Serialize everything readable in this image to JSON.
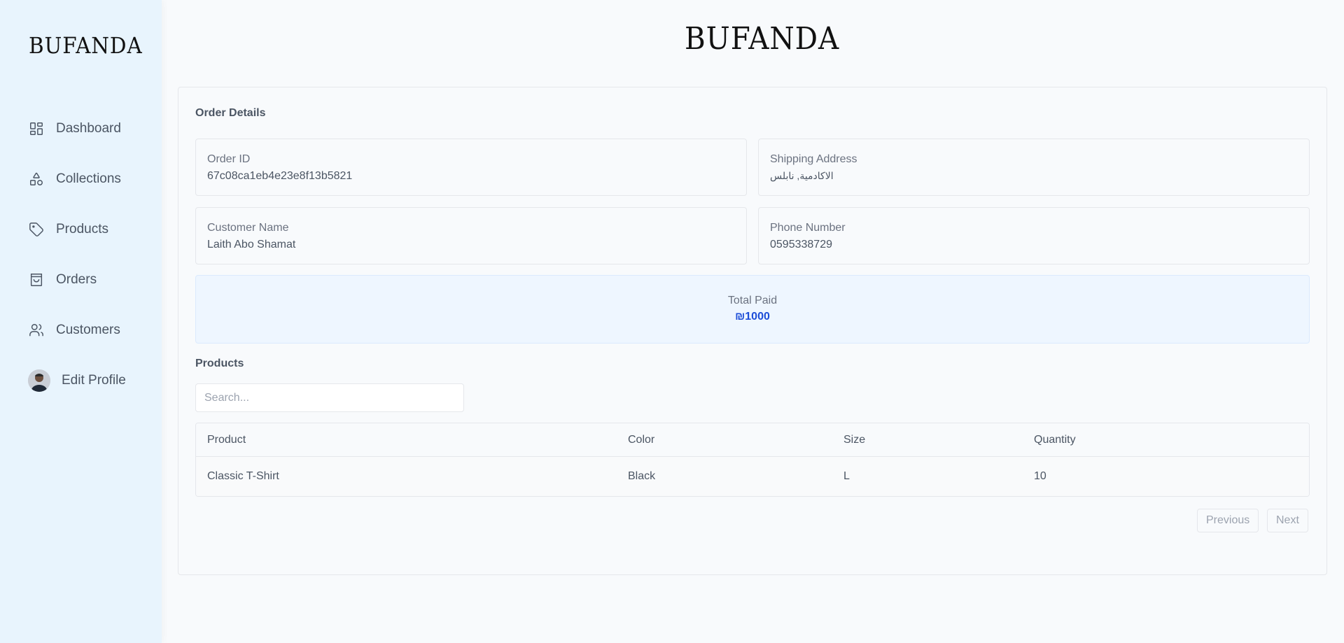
{
  "brand": "BUFANDA",
  "sidebar": {
    "items": [
      {
        "label": "Dashboard",
        "icon": "dashboard-icon"
      },
      {
        "label": "Collections",
        "icon": "shapes-icon"
      },
      {
        "label": "Products",
        "icon": "tag-icon"
      },
      {
        "label": "Orders",
        "icon": "shopping-bag-icon"
      },
      {
        "label": "Customers",
        "icon": "users-icon"
      }
    ],
    "profile_label": "Edit Profile"
  },
  "order": {
    "title": "Order Details",
    "order_id_label": "Order ID",
    "order_id": "67c08ca1eb4e23e8f13b5821",
    "shipping_label": "Shipping Address",
    "shipping": "الاكادمية, نابلس",
    "customer_label": "Customer Name",
    "customer": "Laith Abo Shamat",
    "phone_label": "Phone Number",
    "phone": "0595338729",
    "total_label": "Total Paid",
    "total": "₪1000"
  },
  "products": {
    "title": "Products",
    "search_placeholder": "Search...",
    "columns": [
      "Product",
      "Color",
      "Size",
      "Quantity"
    ],
    "rows": [
      [
        "Classic T-Shirt",
        "Black",
        "L",
        "10"
      ]
    ],
    "prev_label": "Previous",
    "next_label": "Next"
  },
  "colors": {
    "sidebar_bg": "#e8f4fd",
    "accent": "#1d4ed8",
    "total_bg": "#eef6ff"
  }
}
